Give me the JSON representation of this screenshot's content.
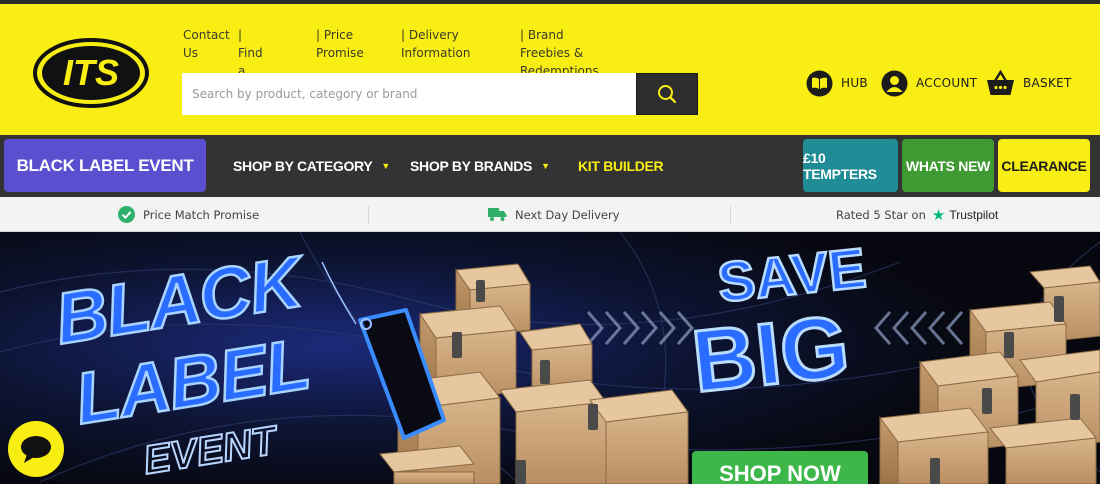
{
  "brand": {
    "logo_text": "ITS",
    "colors": {
      "yellow": "#f8ee13",
      "dark": "#333333",
      "purple": "#5a4fcf",
      "teal": "#1f8c96",
      "green": "#3f9a33"
    }
  },
  "toplinks": [
    "Contact\nUs",
    "|  Find a\nStore",
    "|  Price\nPromise",
    "|  Delivery\nInformation",
    "|  Brand Freebies &\nRedemptions"
  ],
  "search": {
    "placeholder": "Search by product, category or brand",
    "value": "",
    "icon": "search-icon"
  },
  "header_actions": [
    {
      "label": "HUB",
      "icon": "book-icon"
    },
    {
      "label": "ACCOUNT",
      "icon": "user-icon"
    },
    {
      "label": "BASKET",
      "icon": "basket-icon"
    }
  ],
  "nav": {
    "black_label": "BLACK LABEL EVENT",
    "shop_by_category": "SHOP BY CATEGORY",
    "shop_by_brands": "SHOP BY BRANDS",
    "kit_builder": "KIT BUILDER",
    "temptors": "£10 TEMPTERS",
    "whats_new": "WHATS NEW",
    "clearance": "CLEARANCE"
  },
  "usp": {
    "price_match": "Price Match Promise",
    "delivery": "Next Day Delivery",
    "rated": "Rated 5 Star on",
    "trustpilot": "Trustpilot"
  },
  "hero": {
    "line1": "BLACK",
    "line2": "LABEL",
    "line3": "EVENT",
    "save": "SAVE",
    "big": "BIG",
    "cta": "SHOP NOW"
  }
}
